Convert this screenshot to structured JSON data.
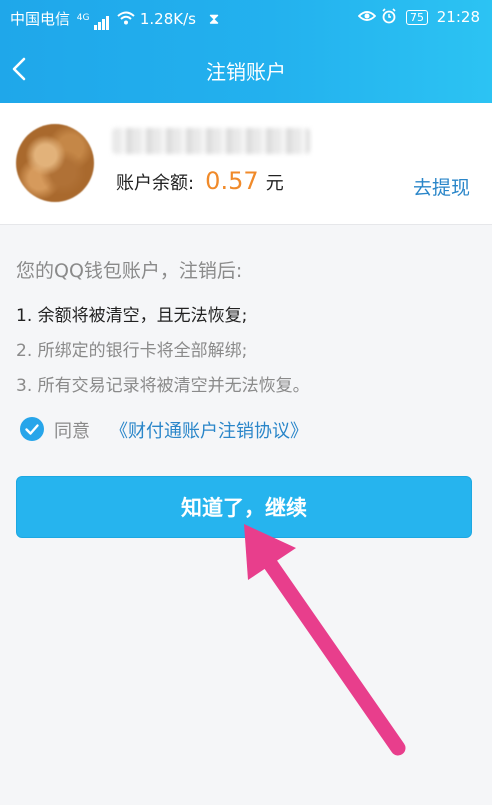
{
  "status_bar": {
    "carrier": "中国电信",
    "network": "4G",
    "speed": "1.28K/s",
    "battery": "75",
    "time": "21:28"
  },
  "nav": {
    "title": "注销账户",
    "back_icon": "chevron-left-icon"
  },
  "account": {
    "balance_label": "账户余额:",
    "balance_amount": "0.57",
    "balance_unit": "元",
    "withdraw_link": "去提现"
  },
  "notice": {
    "intro": "您的QQ钱包账户，注销后:",
    "items": [
      "1. 余额将被清空，且无法恢复;",
      "2. 所绑定的银行卡将全部解绑;",
      "3. 所有交易记录将被清空并无法恢复。"
    ]
  },
  "agreement": {
    "checked": true,
    "agree_text": "同意",
    "link_text": "《财付通账户注销协议》"
  },
  "continue_button": "知道了，继续",
  "colors": {
    "header_blue": "#23b1ee",
    "button_blue": "#26b4ee",
    "amount_orange": "#f08a2a",
    "link_blue": "#2a86c9",
    "annotation_arrow": "#e83e8c"
  }
}
